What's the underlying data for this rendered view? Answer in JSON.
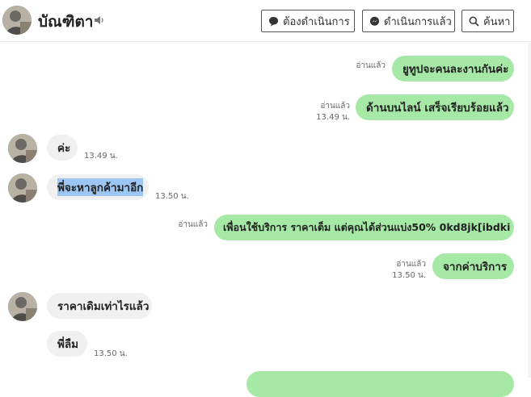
{
  "header": {
    "contact_name": "บัณฑิตา",
    "buttons": {
      "pending": "ต้องดำเนินการ",
      "done": "ดำเนินการแล้ว",
      "search": "ค้นหา"
    }
  },
  "messages": [
    {
      "direction": "outgoing",
      "text": "ยูทูปจะคนละงานกันค่ะ",
      "read": "อ่านแล้ว",
      "time": ""
    },
    {
      "direction": "outgoing",
      "text": "ด้านบนไลน์ เสร็จเรียบร้อยแล้ว",
      "read": "อ่านแล้ว",
      "time": "13.49 น."
    },
    {
      "direction": "incoming",
      "text": "ค่ะ",
      "time": "13.49 น."
    },
    {
      "direction": "incoming",
      "text": "พี่จะหาลูกค้ามาอีก",
      "time": "13.50 น."
    },
    {
      "direction": "outgoing",
      "text": "เพื่อนใช้บริการ ราคาเต็ม แต่คุณได้ส่วนแบ่ง50% 0kd8jk[ibdki",
      "read": "อ่านแล้ว",
      "time": ""
    },
    {
      "direction": "outgoing",
      "text": "จากค่าบริการ",
      "read": "อ่านแล้ว",
      "time": "13.50 น."
    },
    {
      "direction": "incoming",
      "text": "ราคาเดิมเท่าไรแล้ว",
      "time": ""
    },
    {
      "direction": "incoming",
      "text": "พี่ลืม",
      "time": "13.50 น."
    }
  ],
  "icons": {
    "speaker": "speaker-icon",
    "pending": "chat-bubble-icon",
    "done": "messenger-icon",
    "search": "search-icon"
  },
  "colors": {
    "outgoing_bubble": "#a6e8a5",
    "incoming_bubble": "#f0f0f0",
    "selection": "#9ec6f3"
  }
}
